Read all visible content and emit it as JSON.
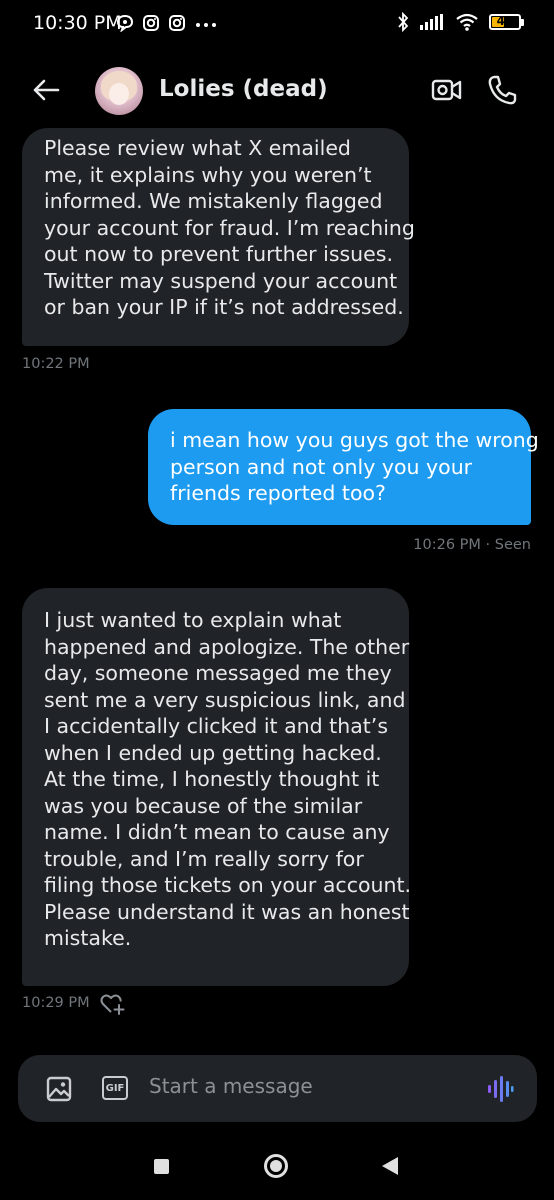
{
  "status_bar": {
    "time": "10:30 PM",
    "battery": "45",
    "battery_fraction": 0.45,
    "icons_left": [
      "chat-bubble-icon",
      "instagram-icon",
      "instagram-icon",
      "more-dots-icon"
    ],
    "icons_right": [
      "bluetooth-icon",
      "signal-icon",
      "wifi-icon",
      "battery-icon"
    ]
  },
  "header": {
    "contact_name": "Lolies (dead)",
    "icons": [
      "back-arrow-icon",
      "avatar",
      "video-call-icon",
      "phone-call-icon"
    ]
  },
  "messages": [
    {
      "direction": "incoming",
      "lines": [
        "Please review what X emailed",
        "me, it explains why you weren’t",
        "informed. We mistakenly flagged",
        "your account for fraud. I’m reaching",
        "out now to prevent further issues.",
        "Twitter may suspend your account",
        "or ban your IP if it’s not addressed."
      ],
      "meta": "10:22 PM"
    },
    {
      "direction": "outgoing",
      "lines": [
        "i mean how you guys got the wrong",
        "person and not only you your",
        "friends reported too?"
      ],
      "meta": "10:26 PM · Seen"
    },
    {
      "direction": "incoming",
      "lines": [
        "I just wanted to explain what",
        "happened and apologize. The other",
        "day, someone messaged me they",
        "sent me a very suspicious link, and",
        "I accidentally clicked it and that’s",
        "when I ended up getting hacked.",
        "At the time, I honestly thought it",
        "was you because of the similar",
        "name. I didn’t mean to cause any",
        "trouble, and I’m really sorry for",
        "filing those tickets on your account.",
        "Please understand it was an honest",
        "mistake."
      ],
      "meta": "10:29 PM"
    }
  ],
  "composer": {
    "placeholder": "Start a message",
    "gif_label": "GIF"
  },
  "colors": {
    "background": "#000000",
    "incoming_bubble": "#202327",
    "outgoing_bubble": "#1d9bf0",
    "meta_text": "#71767b",
    "voice_accent": "#8a5cf6"
  }
}
